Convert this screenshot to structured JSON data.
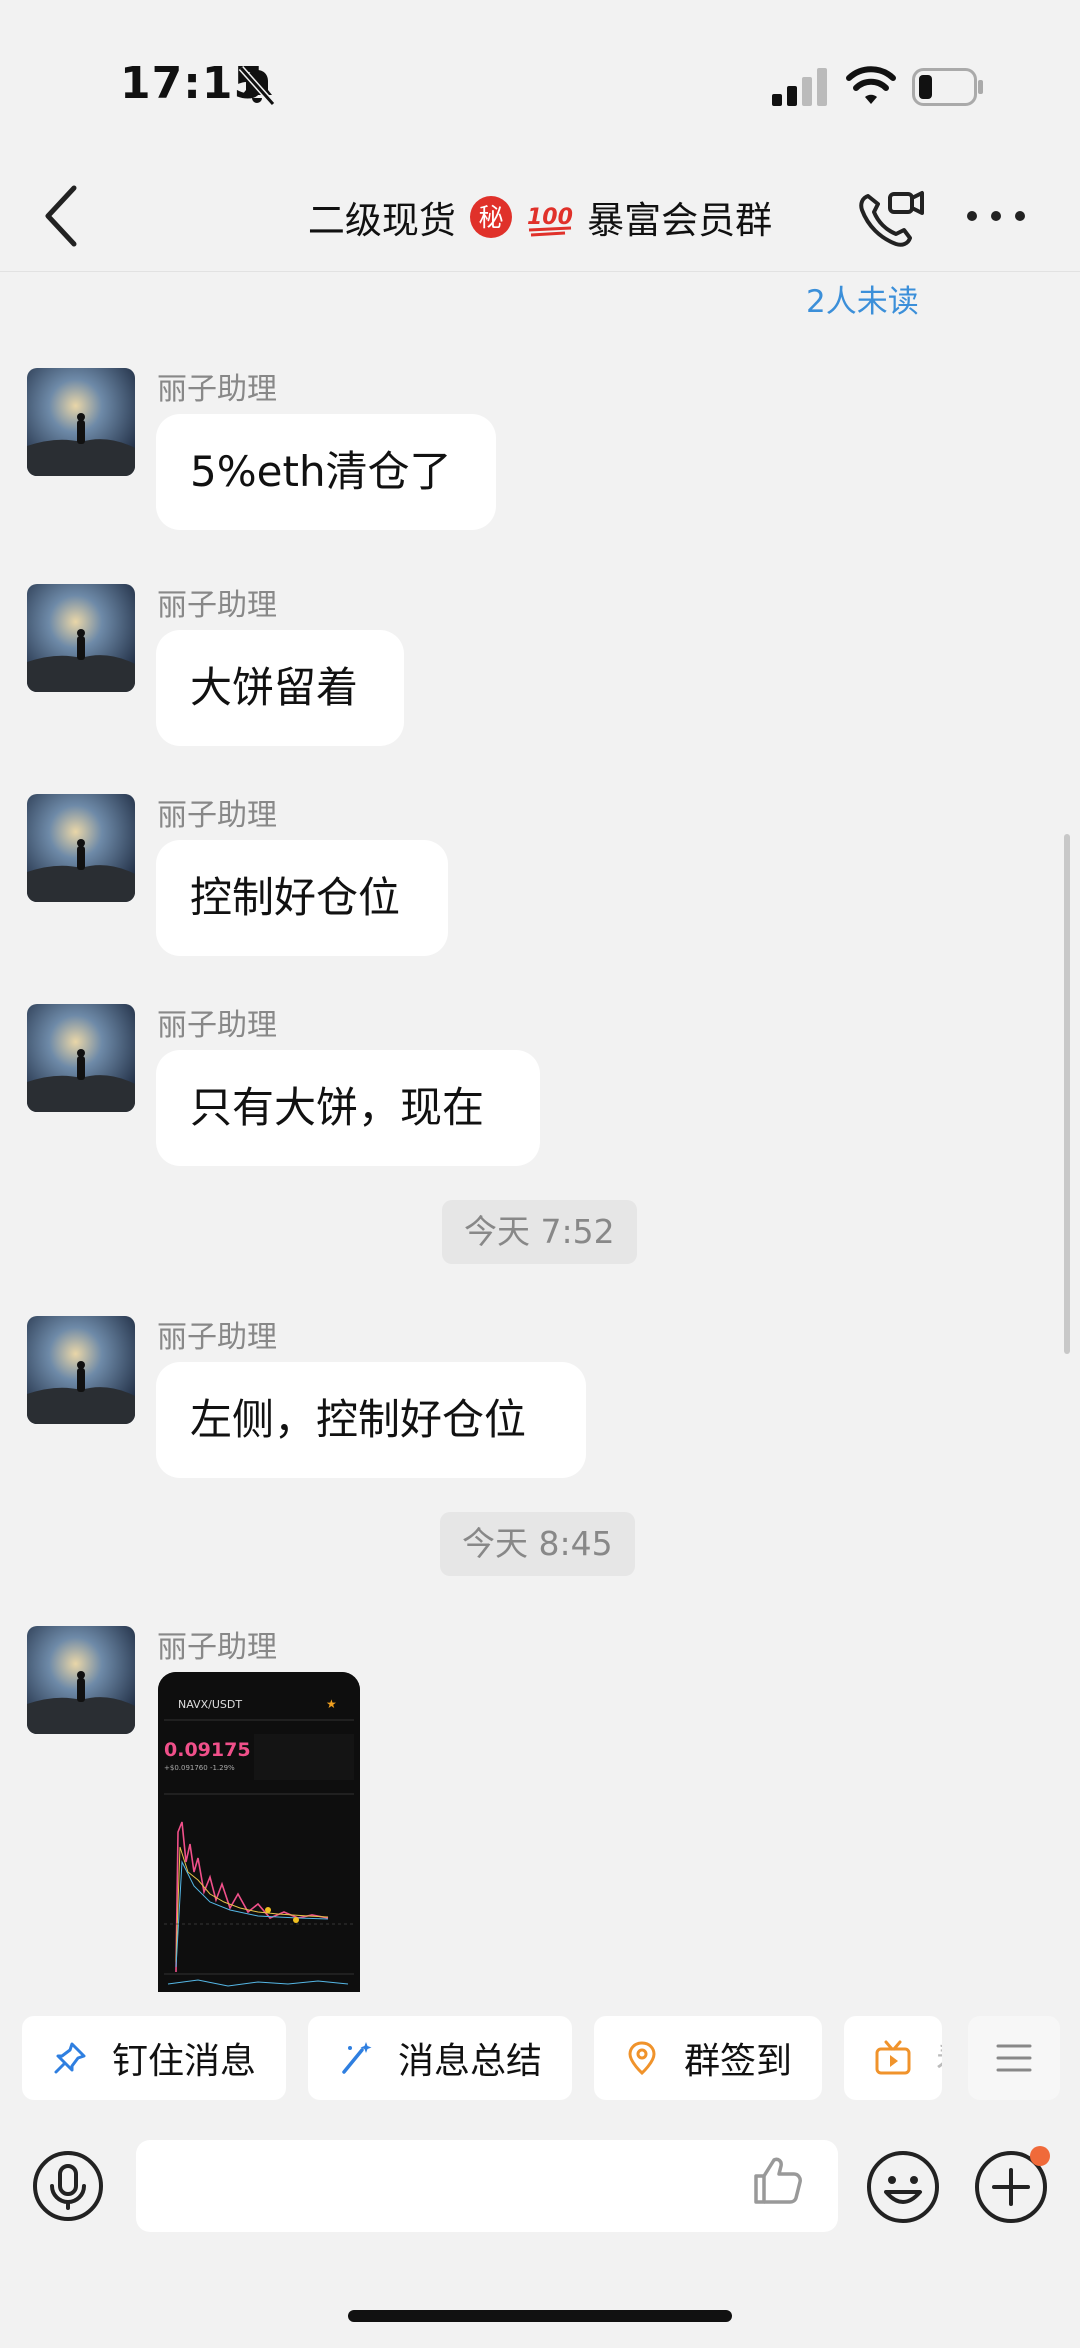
{
  "status_bar": {
    "time": "17:15"
  },
  "header": {
    "title_prefix": "二级现货",
    "badge_secret": "秘",
    "badge_hundred": "100",
    "title_suffix": "暴富会员群"
  },
  "unread_indicator": "2人未读",
  "messages": [
    {
      "sender": "丽子助理",
      "text": "5%eth清仓了"
    },
    {
      "sender": "丽子助理",
      "text": "大饼留着"
    },
    {
      "sender": "丽子助理",
      "text": "控制好仓位"
    },
    {
      "sender": "丽子助理",
      "text": "只有大饼，现在"
    },
    {
      "sender": "丽子助理",
      "text": "左侧，控制好仓位"
    },
    {
      "sender": "丽子助理"
    }
  ],
  "timestamps": [
    "今天 7:52",
    "今天 8:45"
  ],
  "image_preview": {
    "pair": "NAVX/USDT",
    "price": "0.09175",
    "change": "+$0.091760  -1.29%"
  },
  "quick_actions": [
    {
      "label": "钉住消息",
      "icon": "pin-icon"
    },
    {
      "label": "消息总结",
      "icon": "magic-wand-icon"
    },
    {
      "label": "群签到",
      "icon": "location-pin-icon"
    },
    {
      "label": "看",
      "icon": "tv-icon"
    }
  ],
  "colors": {
    "background": "#f2f2f2",
    "bubble": "#ffffff",
    "link_blue": "#3b8fd9",
    "accent_orange": "#f0932b",
    "icon_blue": "#2f7fe0",
    "notification_dot": "#f06a3a"
  }
}
